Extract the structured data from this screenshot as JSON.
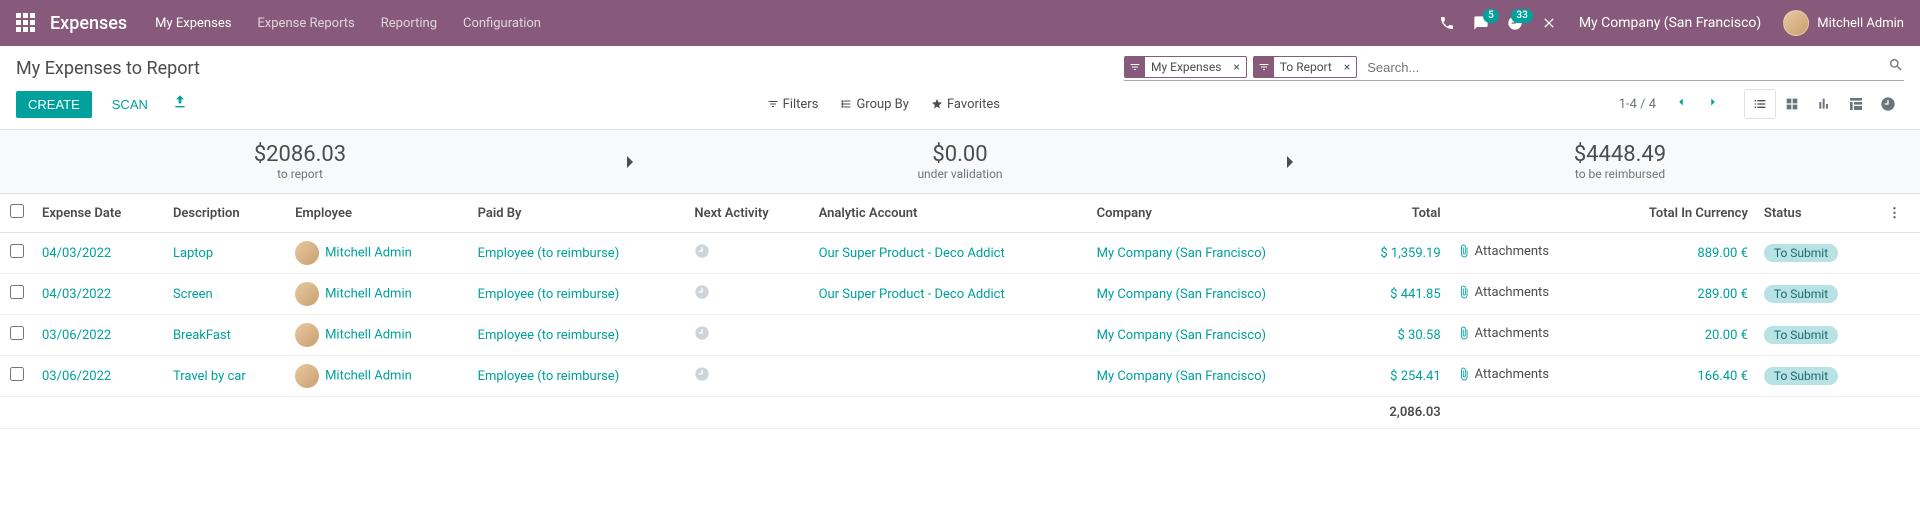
{
  "navbar": {
    "brand": "Expenses",
    "menus": [
      "My Expenses",
      "Expense Reports",
      "Reporting",
      "Configuration"
    ],
    "discuss_badge": "5",
    "activities_badge": "33",
    "company": "My Company (San Francisco)",
    "user": "Mitchell Admin"
  },
  "breadcrumb": "My Expenses to Report",
  "facets": [
    {
      "label": "My Expenses"
    },
    {
      "label": "To Report"
    }
  ],
  "search_placeholder": "Search...",
  "buttons": {
    "create": "CREATE",
    "scan": "SCAN"
  },
  "search_options": {
    "filters": "Filters",
    "groupby": "Group By",
    "favorites": "Favorites"
  },
  "pager": "1-4 / 4",
  "status": {
    "to_report_amount": "$2086.03",
    "to_report_label": "to report",
    "under_validation_amount": "$0.00",
    "under_validation_label": "under validation",
    "to_reimburse_amount": "$4448.49",
    "to_reimburse_label": "to be reimbursed"
  },
  "columns": {
    "date": "Expense Date",
    "description": "Description",
    "employee": "Employee",
    "paid_by": "Paid By",
    "next_activity": "Next Activity",
    "analytic": "Analytic Account",
    "company": "Company",
    "total": "Total",
    "attachments": "Attachments",
    "total_currency": "Total In Currency",
    "status": "Status"
  },
  "rows": [
    {
      "date": "04/03/2022",
      "description": "Laptop",
      "employee": "Mitchell Admin",
      "paid_by": "Employee (to reimburse)",
      "analytic": "Our Super Product - Deco Addict",
      "company": "My Company (San Francisco)",
      "total": "$ 1,359.19",
      "total_currency": "889.00 €",
      "status": "To Submit"
    },
    {
      "date": "04/03/2022",
      "description": "Screen",
      "employee": "Mitchell Admin",
      "paid_by": "Employee (to reimburse)",
      "analytic": "Our Super Product - Deco Addict",
      "company": "My Company (San Francisco)",
      "total": "$ 441.85",
      "total_currency": "289.00 €",
      "status": "To Submit"
    },
    {
      "date": "03/06/2022",
      "description": "BreakFast",
      "employee": "Mitchell Admin",
      "paid_by": "Employee (to reimburse)",
      "analytic": "",
      "company": "My Company (San Francisco)",
      "total": "$ 30.58",
      "total_currency": "20.00 €",
      "status": "To Submit"
    },
    {
      "date": "03/06/2022",
      "description": "Travel by car",
      "employee": "Mitchell Admin",
      "paid_by": "Employee (to reimburse)",
      "analytic": "",
      "company": "My Company (San Francisco)",
      "total": "$ 254.41",
      "total_currency": "166.40 €",
      "status": "To Submit"
    }
  ],
  "footer_total": "2,086.03"
}
